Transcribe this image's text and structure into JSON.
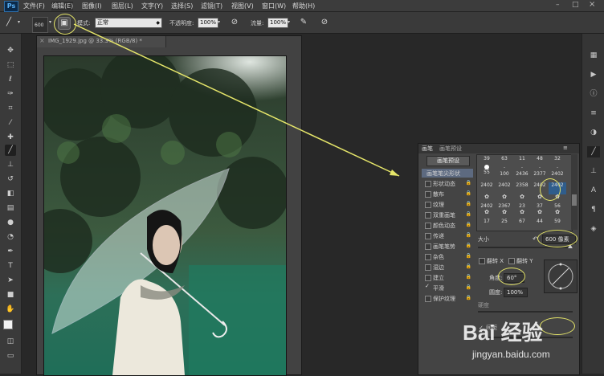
{
  "app": {
    "logo": "Ps"
  },
  "menu": [
    "文件(F)",
    "编辑(E)",
    "图像(I)",
    "图层(L)",
    "文字(Y)",
    "选择(S)",
    "滤镜(T)",
    "视图(V)",
    "窗口(W)",
    "帮助(H)"
  ],
  "options": {
    "brush_size": "600",
    "mode_label": "模式:",
    "mode_value": "正常",
    "opacity_label": "不透明度:",
    "opacity_value": "100%",
    "flow_label": "流量:",
    "flow_value": "100%"
  },
  "document": {
    "tab_title": "IMG_1929.jpg @ 33.3% (RGB/8) *"
  },
  "brush_panel": {
    "tabs": [
      "画笔",
      "画笔预设"
    ],
    "preset_button": "画笔预设",
    "options": [
      {
        "label": "画笔笔尖形状",
        "selected": true
      },
      {
        "label": "形状动态"
      },
      {
        "label": "散布"
      },
      {
        "label": "纹理"
      },
      {
        "label": "双重画笔"
      },
      {
        "label": "颜色动态"
      },
      {
        "label": "传递"
      },
      {
        "label": "画笔笔势"
      },
      {
        "label": "杂色"
      },
      {
        "label": "湿边"
      },
      {
        "label": "建立"
      },
      {
        "label": "平滑",
        "checked": true
      },
      {
        "label": "保护纹理"
      }
    ],
    "tip_numbers": [
      "39",
      "63",
      "11",
      "48",
      "32",
      "55",
      "100",
      "2436",
      "2377",
      "2402",
      "2402",
      "2402",
      "2358",
      "2402",
      "2402",
      "2402",
      "2367",
      "23",
      "37",
      "56",
      "17",
      "25",
      "67",
      "44",
      "59"
    ],
    "size_label": "大小",
    "size_value": "600 像素",
    "flip_x": "翻转 X",
    "flip_y": "翻转 Y",
    "angle_label": "角度:",
    "angle_value": "60°",
    "roundness_label": "圆度:",
    "roundness_value": "100%",
    "hardness_label": "硬度",
    "spacing_label": "间距"
  },
  "watermark": {
    "brand": "Bai 经验",
    "url": "jingyan.baidu.com"
  },
  "colors": {
    "accent_highlight": "#e6e66a",
    "selected_row": "#5d6a80"
  },
  "icons": [
    "ps-logo-icon",
    "brush-tool-icon",
    "brush-preset-icon",
    "airbrush-icon",
    "pressure-icon",
    "lock-icon",
    "move-tool-icon",
    "marquee-tool-icon",
    "lasso-tool-icon",
    "crop-tool-icon",
    "eyedropper-icon",
    "heal-icon",
    "brush-icon",
    "stamp-icon",
    "history-brush-icon",
    "eraser-icon",
    "gradient-icon",
    "blur-icon",
    "dodge-icon",
    "pen-icon",
    "type-icon",
    "path-select-icon",
    "shape-icon",
    "hand-icon",
    "zoom-icon"
  ]
}
